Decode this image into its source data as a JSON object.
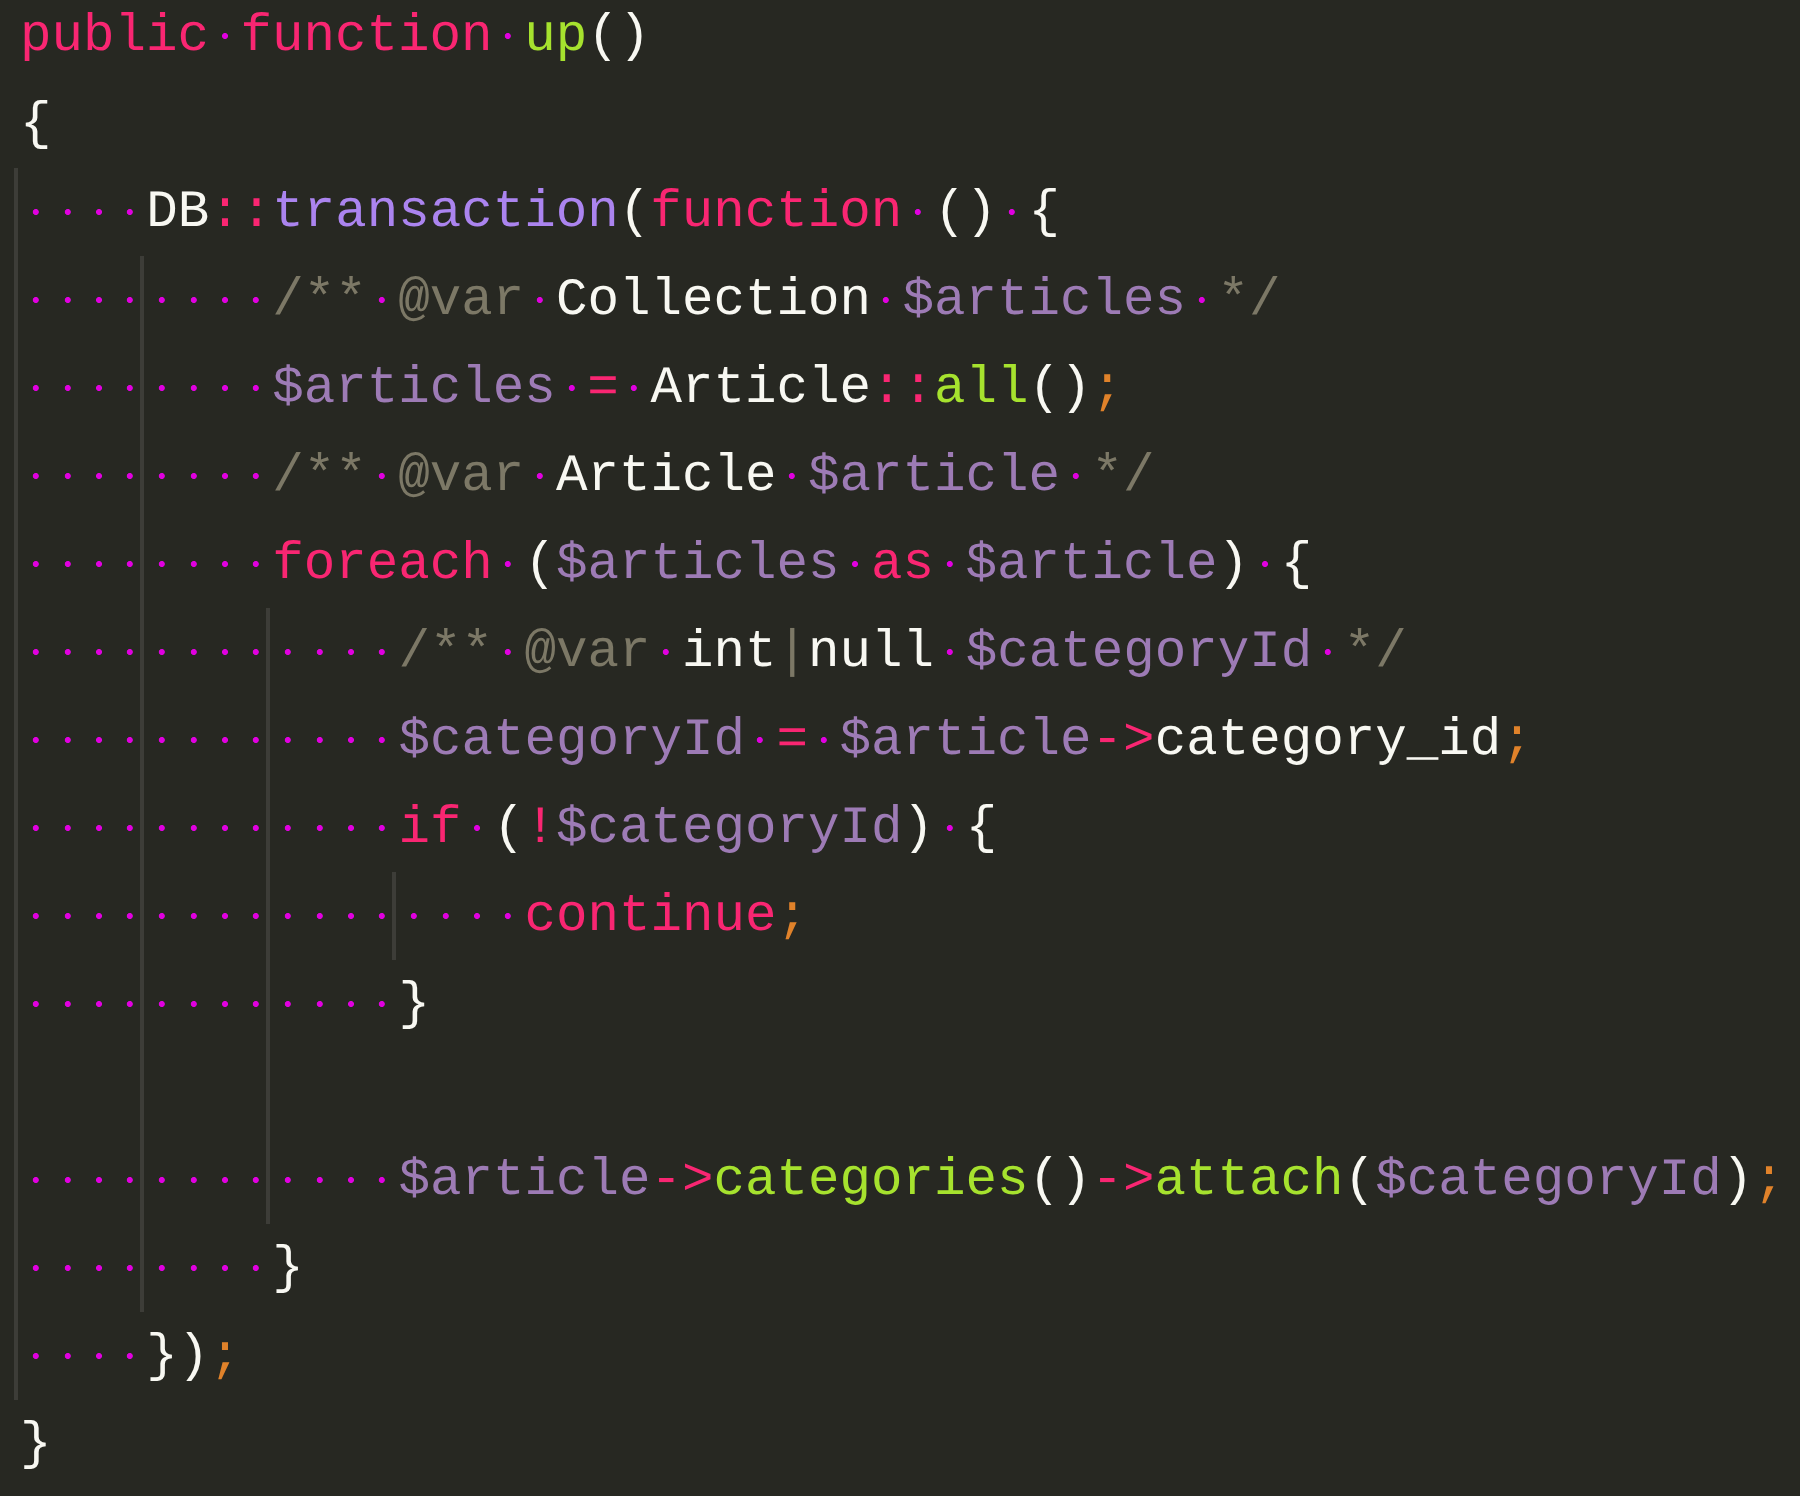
{
  "editor": {
    "lines": [
      {
        "tokens": [
          {
            "text": "public function ",
            "kind": "keyword"
          },
          {
            "text": "up",
            "kind": "function"
          },
          {
            "text": "()",
            "kind": "plain"
          }
        ]
      },
      {
        "tokens": [
          {
            "text": "{",
            "kind": "plain"
          }
        ]
      },
      {
        "tokens": [
          {
            "text": "    DB",
            "kind": "plain"
          },
          {
            "text": "::",
            "kind": "operator"
          },
          {
            "text": "transaction",
            "kind": "method"
          },
          {
            "text": "(",
            "kind": "plain"
          },
          {
            "text": "function",
            "kind": "keyword"
          },
          {
            "text": " () {",
            "kind": "plain"
          }
        ]
      },
      {
        "tokens": [
          {
            "text": "        /** @var ",
            "kind": "comment"
          },
          {
            "text": "Collection ",
            "kind": "plain"
          },
          {
            "text": "$articles ",
            "kind": "variable"
          },
          {
            "text": "*/",
            "kind": "comment"
          }
        ]
      },
      {
        "tokens": [
          {
            "text": "        $articles ",
            "kind": "variable"
          },
          {
            "text": "= ",
            "kind": "operator"
          },
          {
            "text": "Article",
            "kind": "plain"
          },
          {
            "text": "::",
            "kind": "operator"
          },
          {
            "text": "all",
            "kind": "function"
          },
          {
            "text": "()",
            "kind": "plain"
          },
          {
            "text": ";",
            "kind": "semicolon"
          }
        ]
      },
      {
        "tokens": [
          {
            "text": "        /** @var ",
            "kind": "comment"
          },
          {
            "text": "Article ",
            "kind": "plain"
          },
          {
            "text": "$article ",
            "kind": "variable"
          },
          {
            "text": "*/",
            "kind": "comment"
          }
        ]
      },
      {
        "tokens": [
          {
            "text": "        foreach ",
            "kind": "keyword"
          },
          {
            "text": "(",
            "kind": "plain"
          },
          {
            "text": "$articles ",
            "kind": "variable"
          },
          {
            "text": "as ",
            "kind": "keyword"
          },
          {
            "text": "$article",
            "kind": "variable"
          },
          {
            "text": ") {",
            "kind": "plain"
          }
        ]
      },
      {
        "tokens": [
          {
            "text": "            /** @var ",
            "kind": "comment"
          },
          {
            "text": "int",
            "kind": "plain"
          },
          {
            "text": "|",
            "kind": "comment"
          },
          {
            "text": "null ",
            "kind": "plain"
          },
          {
            "text": "$categoryId ",
            "kind": "variable"
          },
          {
            "text": "*/",
            "kind": "comment"
          }
        ]
      },
      {
        "tokens": [
          {
            "text": "            $categoryId ",
            "kind": "variable"
          },
          {
            "text": "= ",
            "kind": "operator"
          },
          {
            "text": "$article",
            "kind": "variable"
          },
          {
            "text": "->",
            "kind": "operator"
          },
          {
            "text": "category_id",
            "kind": "plain"
          },
          {
            "text": ";",
            "kind": "semicolon"
          }
        ]
      },
      {
        "tokens": [
          {
            "text": "            if ",
            "kind": "keyword"
          },
          {
            "text": "(",
            "kind": "plain"
          },
          {
            "text": "!",
            "kind": "operator"
          },
          {
            "text": "$categoryId",
            "kind": "variable"
          },
          {
            "text": ") {",
            "kind": "plain"
          }
        ]
      },
      {
        "tokens": [
          {
            "text": "                continue",
            "kind": "keyword"
          },
          {
            "text": ";",
            "kind": "semicolon"
          }
        ]
      },
      {
        "tokens": [
          {
            "text": "            }",
            "kind": "plain"
          }
        ]
      },
      {
        "kind": "blank"
      },
      {
        "tokens": [
          {
            "text": "            $article",
            "kind": "variable"
          },
          {
            "text": "->",
            "kind": "operator"
          },
          {
            "text": "categories",
            "kind": "function"
          },
          {
            "text": "()",
            "kind": "plain"
          },
          {
            "text": "->",
            "kind": "operator"
          },
          {
            "text": "attach",
            "kind": "function"
          },
          {
            "text": "(",
            "kind": "plain"
          },
          {
            "text": "$categoryId",
            "kind": "variable"
          },
          {
            "text": ")",
            "kind": "plain"
          },
          {
            "text": ";",
            "kind": "semicolon"
          }
        ]
      },
      {
        "tokens": [
          {
            "text": "        }",
            "kind": "plain"
          }
        ]
      },
      {
        "tokens": [
          {
            "text": "    })",
            "kind": "plain"
          },
          {
            "text": ";",
            "kind": "semicolon"
          }
        ]
      },
      {
        "tokens": [
          {
            "text": "}",
            "kind": "plain"
          }
        ]
      }
    ]
  }
}
